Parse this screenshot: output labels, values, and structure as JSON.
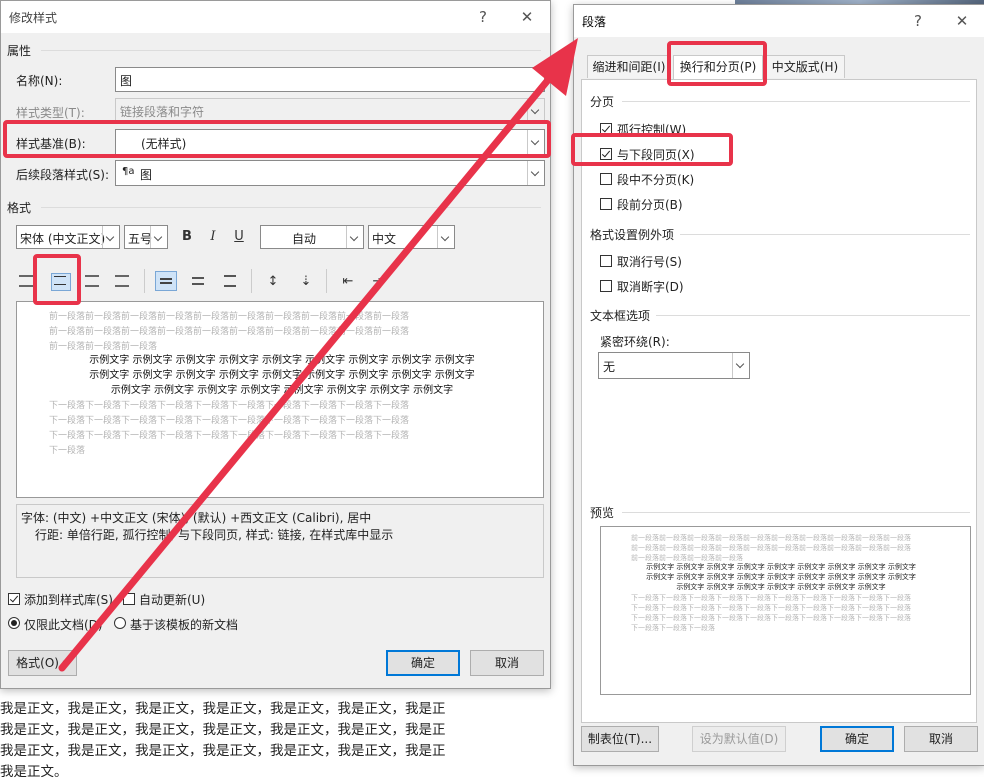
{
  "background_doc": {
    "lines": [
      "我是正文，我是正文，我是正文，我是正文，我是正文，我是正文，我是正",
      "我是正文，我是正文，我是正文，我是正文，我是正文，我是正文，我是正",
      "我是正文，我是正文，我是正文，我是正文，我是正文，我是正文，我是正",
      "我是正文。"
    ]
  },
  "modify_style": {
    "title": "修改样式",
    "help": "?",
    "close": "✕",
    "section_properties": "属性",
    "name_label": "名称(N):",
    "name_value": "图",
    "style_type_label": "样式类型(T):",
    "style_type_value": "链接段落和字符",
    "based_on_label": "样式基准(B):",
    "based_on_value": "(无样式)",
    "next_style_label": "后续段落样式(S):",
    "next_style_icon": "¶a",
    "next_style_value": "图",
    "section_format": "格式",
    "font_name": "宋体 (中文正文)",
    "font_size": "五号",
    "bold": "B",
    "italic": "I",
    "underline": "U",
    "color_value": "自动",
    "script_value": "中文",
    "preview_before": [
      "前一段落前一段落前一段落前一段落前一段落前一段落前一段落前一段落前一段落前一段落",
      "前一段落前一段落前一段落前一段落前一段落前一段落前一段落前一段落前一段落前一段落",
      "前一段落前一段落前一段落"
    ],
    "preview_sample": [
      "示例文字 示例文字 示例文字 示例文字 示例文字 示例文字 示例文字 示例文字 示例文字",
      "示例文字 示例文字 示例文字 示例文字 示例文字 示例文字 示例文字 示例文字 示例文字",
      "示例文字 示例文字 示例文字 示例文字 示例文字 示例文字 示例文字 示例文字"
    ],
    "preview_after": [
      "下一段落下一段落下一段落下一段落下一段落下一段落下一段落下一段落下一段落下一段落",
      "下一段落下一段落下一段落下一段落下一段落下一段落下一段落下一段落下一段落下一段落",
      "下一段落下一段落下一段落下一段落下一段落下一段落下一段落下一段落下一段落下一段落",
      "下一段落"
    ],
    "description_line1": "字体: (中文) +中文正文 (宋体), (默认) +西文正文 (Calibri), 居中",
    "description_line2": "行距: 单倍行距, 孤行控制, 与下段同页, 样式: 链接, 在样式库中显示",
    "add_to_gallery": "添加到样式库(S)",
    "auto_update": "自动更新(U)",
    "only_this_doc": "仅限此文档(D)",
    "new_docs_template": "基于该模板的新文档",
    "format_button": "格式(O) ▾",
    "ok": "确定",
    "cancel": "取消"
  },
  "paragraph": {
    "title": "段落",
    "help": "?",
    "close": "✕",
    "tabs": [
      "缩进和间距(I)",
      "换行和分页(P)",
      "中文版式(H)"
    ],
    "section_pagination": "分页",
    "widow_control": "孤行控制(W)",
    "keep_with_next": "与下段同页(X)",
    "keep_lines_together": "段中不分页(K)",
    "page_break_before": "段前分页(B)",
    "section_exceptions": "格式设置例外项",
    "suppress_line_numbers": "取消行号(S)",
    "dont_hyphenate": "取消断字(D)",
    "section_textbox": "文本框选项",
    "tight_wrap_label": "紧密环绕(R):",
    "tight_wrap_value": "无",
    "section_preview": "预览",
    "preview_before": [
      "前一段落前一段落前一段落前一段落前一段落前一段落前一段落前一段落前一段落前一段落",
      "前一段落前一段落前一段落前一段落前一段落前一段落前一段落前一段落前一段落前一段落",
      "前一段落前一段落前一段落前一段落"
    ],
    "preview_sample": [
      "示例文字 示例文字 示例文字 示例文字 示例文字 示例文字 示例文字 示例文字 示例文字",
      "示例文字 示例文字 示例文字 示例文字 示例文字 示例文字 示例文字 示例文字 示例文字",
      "示例文字 示例文字 示例文字 示例文字 示例文字 示例文字 示例文字"
    ],
    "preview_after": [
      "下一段落下一段落下一段落下一段落下一段落下一段落下一段落下一段落下一段落下一段落",
      "下一段落下一段落下一段落下一段落下一段落下一段落下一段落下一段落下一段落下一段落",
      "下一段落下一段落下一段落下一段落下一段落下一段落下一段落下一段落下一段落下一段落",
      "下一段落下一段落下一段落"
    ],
    "tabs_button": "制表位(T)...",
    "set_default": "设为默认值(D)",
    "ok": "确定",
    "cancel": "取消"
  },
  "annotation": {
    "color": "#e8334a"
  }
}
